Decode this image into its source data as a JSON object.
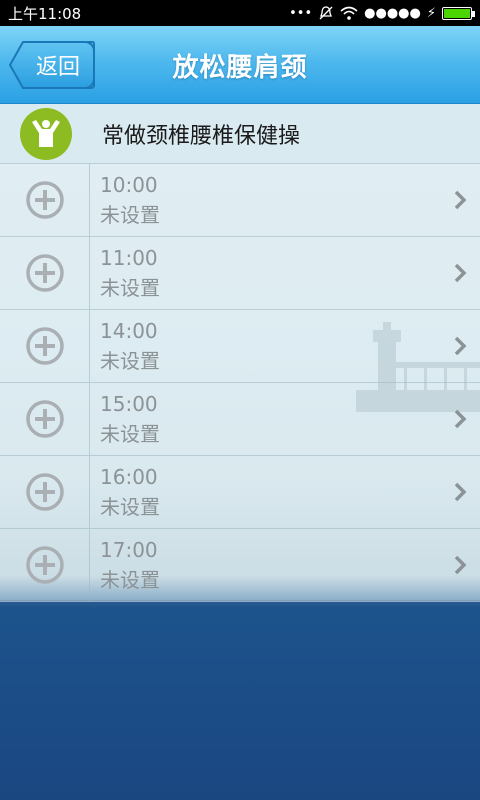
{
  "status_bar": {
    "time": "上午11:08",
    "signal_dots": "●●●●●"
  },
  "header": {
    "back_label": "返回",
    "title": "放松腰肩颈"
  },
  "section": {
    "title": "常做颈椎腰椎保健操"
  },
  "reminders": [
    {
      "time": "10:00",
      "status": "未设置"
    },
    {
      "time": "11:00",
      "status": "未设置"
    },
    {
      "time": "14:00",
      "status": "未设置"
    },
    {
      "time": "15:00",
      "status": "未设置"
    },
    {
      "time": "16:00",
      "status": "未设置"
    },
    {
      "time": "17:00",
      "status": "未设置"
    }
  ],
  "colors": {
    "header": "#2aa0e4",
    "logo": "#8dbc22",
    "battery": "#4cd400"
  }
}
